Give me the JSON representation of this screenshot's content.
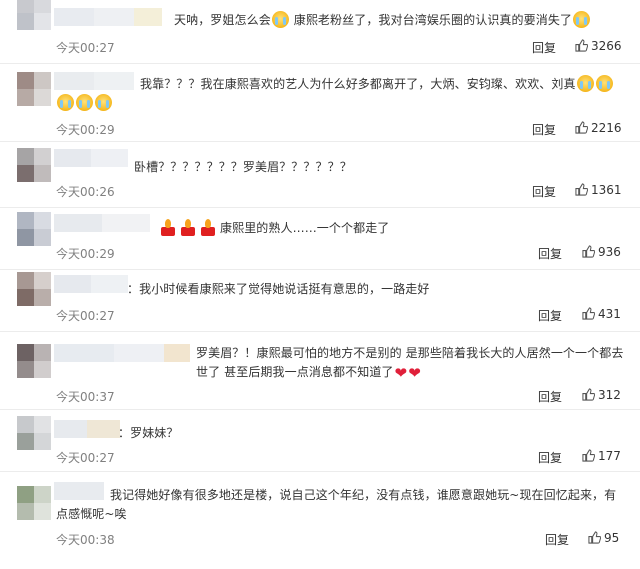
{
  "comments": [
    {
      "text_html": "天呐，罗姐怎么会<E> 康熙老粉丝了，我对台湾娱乐圈的认识真的要消失了<E>",
      "time": "今天00:27",
      "reply": "回复",
      "likes": "3266"
    },
    {
      "text_html": "我靠？？？我在康熙喜欢的艺人为什么好多都离开了，大炳、安钧璨、欢欢、刘真<E><E><E><E><E>",
      "time": "今天00:29",
      "reply": "回复",
      "likes": "2216"
    },
    {
      "text_html": "卧槽？？？？？？？罗美眉？？？？？？",
      "time": "今天00:26",
      "reply": "回复",
      "likes": "1361"
    },
    {
      "text_html": "康熙里的熟人……一个个都走了",
      "time": "今天00:29",
      "reply": "回复",
      "likes": "936"
    },
    {
      "text_html": "：我小时候看康熙来了觉得她说话挺有意思的，一路走好",
      "time": "今天00:27",
      "reply": "回复",
      "likes": "431"
    },
    {
      "text_html": "罗美眉？！康熙最可怕的地方不是别的 是那些陪着我长大的人居然一个一个都去世了 甚至后期我一点消息都不知道了",
      "time": "今天00:37",
      "reply": "回复",
      "likes": "312"
    },
    {
      "text_html": "：罗妹妹？",
      "time": "今天00:27",
      "reply": "回复",
      "likes": "177"
    },
    {
      "text_html": "我记得她好像有很多地还是楼，说自己这个年纪，没有点钱，谁愿意跟她玩~现在回忆起来，有点感慨呢~唉",
      "time": "今天00:38",
      "reply": "回复",
      "likes": "95"
    }
  ],
  "colors": {
    "text": "#333333",
    "time": "#808080",
    "divider": "#ececec",
    "emoji": "#f5b81f",
    "candle": "#e02020",
    "heart": "#e0203a"
  },
  "icons": [
    "blurred-avatar",
    "crying-emoji-icon",
    "candle-icon",
    "broken-heart-icon",
    "thumbs-up-icon"
  ]
}
